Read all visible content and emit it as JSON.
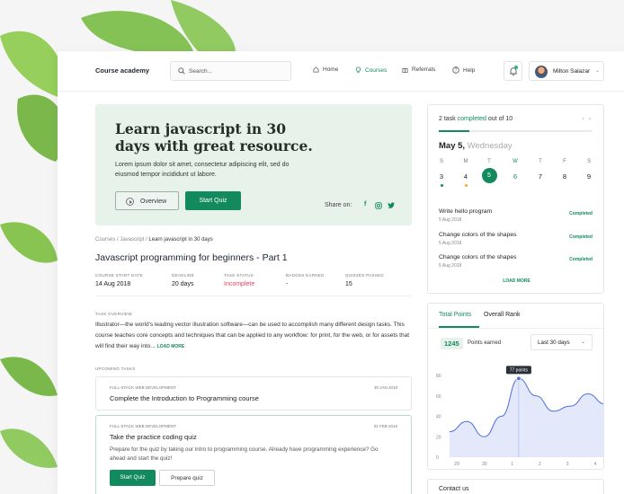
{
  "app": {
    "title": "Course academy"
  },
  "search": {
    "placeholder": "Search..."
  },
  "nav": [
    {
      "label": "Home",
      "icon": "home-icon"
    },
    {
      "label": "Courses",
      "icon": "bulb-icon",
      "active": true
    },
    {
      "label": "Referrals",
      "icon": "gift-icon"
    },
    {
      "label": "Help",
      "icon": "help-icon"
    }
  ],
  "user": {
    "name": "Milton Salazar"
  },
  "hero": {
    "title": "Learn javascript in 30 days with great resource.",
    "body": "Lorem ipsum dolor sit amet, consectetur adipiscing elit, sed do eiusmod tempor incididunt ut labore.",
    "overview_label": "Overview",
    "start_quiz_label": "Start Quiz",
    "share_label": "Share on:",
    "social": [
      "facebook-icon",
      "instagram-icon",
      "twitter-icon"
    ]
  },
  "breadcrumb": {
    "items": [
      "Courses",
      "Javascript"
    ],
    "current": "Learn javascript in 30 days"
  },
  "course": {
    "title": "Javascript programming for beginners - Part 1",
    "stats": [
      {
        "label": "COURSE START DATE",
        "value": "14 Aug 2018"
      },
      {
        "label": "DEADLINE",
        "value": "20 days"
      },
      {
        "label": "TASK STATUS",
        "value": "Incomplete",
        "color": "#e3445f"
      },
      {
        "label": "BADGES EARNED",
        "value": "-"
      },
      {
        "label": "QUIZZES PASSED",
        "value": "15"
      }
    ]
  },
  "task_overview": {
    "label": "TASK OVERVIEW",
    "text": "Illustrator—the world's leading vector illustration software—can be used to accomplish many different design tasks. This course teaches core concepts and techniques that can be applied to any workflow: for print, for the web, or for assets that will find their way into...",
    "load_more": "LOAD MORE"
  },
  "upcoming": {
    "label": "UPCOMING TASKS",
    "tasks": [
      {
        "category": "FULL-STACK WEB DEVELOPMENT",
        "date": "30 JAN 2019",
        "title": "Complete the Introduction to Programming course"
      },
      {
        "category": "FULL-STACK WEB DEVELOPMENT",
        "date": "01 FEB 2019",
        "title": "Take the practice coding quiz",
        "description": "Prepare for the quiz by taking our intro to programming course. Already have programming experience? Go ahead and start the quiz!",
        "primary": "Start Quiz",
        "secondary": "Prepare quiz"
      }
    ]
  },
  "progress": {
    "pre": "2 task",
    "completed": "completed",
    "post": "out of 10",
    "done": 2,
    "total": 10
  },
  "calendar": {
    "date": "May 5,",
    "weekday": "Wednesday",
    "days": [
      {
        "dow": "S",
        "num": "3",
        "dot": "#138a5e"
      },
      {
        "dow": "M",
        "num": "4",
        "dot": "#f5a623"
      },
      {
        "dow": "T",
        "num": "5",
        "selected": true
      },
      {
        "dow": "W",
        "num": "6",
        "green": true
      },
      {
        "dow": "T",
        "num": "7"
      },
      {
        "dow": "F",
        "num": "8"
      },
      {
        "dow": "S",
        "num": "9"
      }
    ]
  },
  "task_list": [
    {
      "name": "Write hello program",
      "date": "5 Aug 2018",
      "status": "Completed"
    },
    {
      "name": "Change colors of the shapes",
      "date": "5 Aug 2018",
      "status": "Completed"
    },
    {
      "name": "Change colors of the shapes",
      "date": "5 Aug 2018",
      "status": "Completed"
    }
  ],
  "task_list_more": "LOAD MORE",
  "points": {
    "tabs": [
      "Total Points",
      "Overall Rank"
    ],
    "value": "1245",
    "label": "Points earned",
    "range": "Last 30 days"
  },
  "chart_data": {
    "type": "area",
    "x": [
      "29",
      "30",
      "1",
      "2",
      "3",
      "4"
    ],
    "y_ticks": [
      "0",
      "20",
      "40",
      "60",
      "80"
    ],
    "ylim": [
      0,
      80
    ],
    "series": [
      {
        "values": [
          25,
          35,
          20,
          40,
          77,
          60,
          45,
          50,
          62,
          52
        ]
      }
    ],
    "tooltip": "77 points",
    "color": "#4a6ee0"
  },
  "contact": {
    "title": "Contact us"
  }
}
